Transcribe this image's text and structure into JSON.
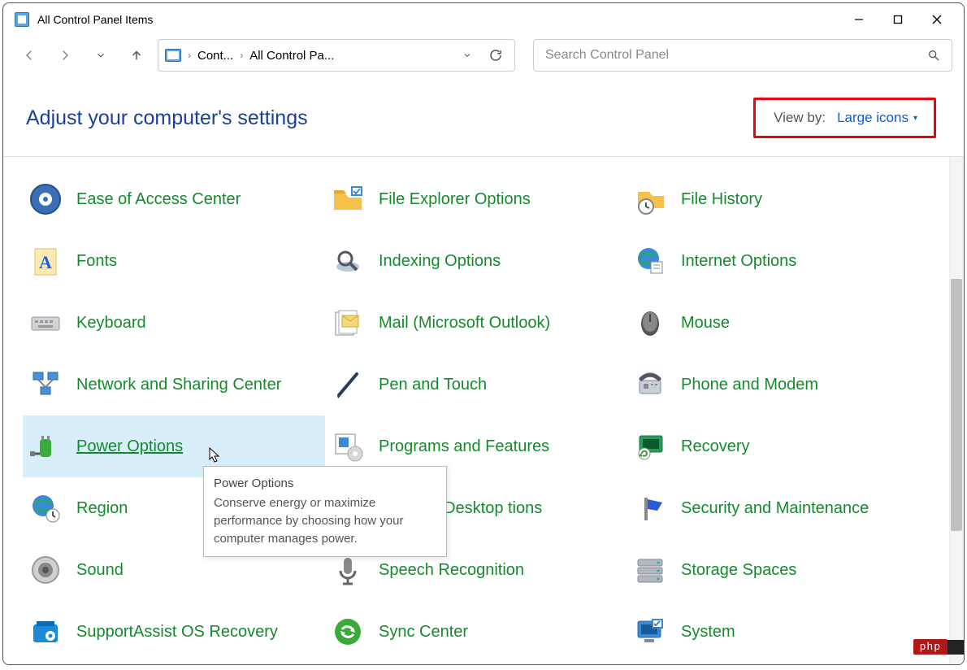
{
  "titlebar": {
    "title": "All Control Panel Items"
  },
  "address": {
    "crumb1": "Cont...",
    "crumb2": "All Control Pa..."
  },
  "search": {
    "placeholder": "Search Control Panel"
  },
  "subhead": {
    "title": "Adjust your computer's settings",
    "viewby_label": "View by:",
    "viewby_value": "Large icons"
  },
  "items": [
    "Ease of Access Center",
    "File Explorer Options",
    "File History",
    "Fonts",
    "Indexing Options",
    "Internet Options",
    "Keyboard",
    "Mail (Microsoft Outlook)",
    "Mouse",
    "Network and Sharing Center",
    "Pen and Touch",
    "Phone and Modem",
    "Power Options",
    "Programs and Features",
    "Recovery",
    "Region",
    "RemoteApp and Desktop Connections",
    "Security and Maintenance",
    "Sound",
    "Speech Recognition",
    "Storage Spaces",
    "SupportAssist OS Recovery",
    "Sync Center",
    "System"
  ],
  "item16_display": "App and Desktop tions",
  "hovered_index": 12,
  "tooltip": {
    "title": "Power Options",
    "body": "Conserve energy or maximize performance by choosing how your computer manages power."
  },
  "badge": "php",
  "colors": {
    "link_green": "#158a2d",
    "heading_blue": "#1a3f9c",
    "highlight_red": "#e30613",
    "hover_bg": "#d9eefb"
  }
}
